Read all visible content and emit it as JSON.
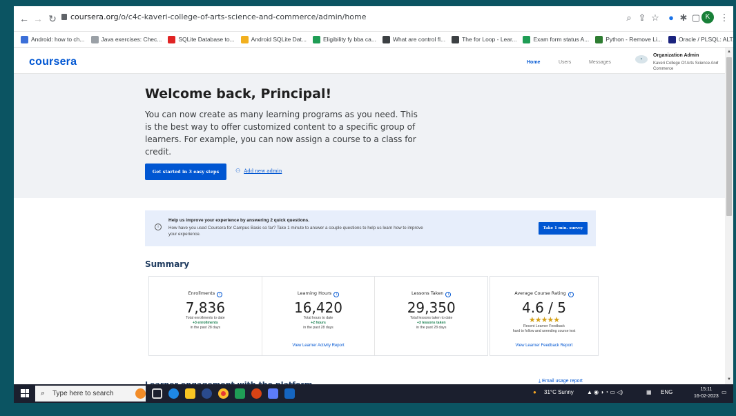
{
  "browser": {
    "url_host": "coursera.org",
    "url_path": "/o/c4c-kaveri-college-of-arts-science-and-commerce/admin/home",
    "profile_initial": "K",
    "bookmarks": [
      {
        "label": "Android: how to ch...",
        "color": "#3b6fd8"
      },
      {
        "label": "Java exercises: Chec...",
        "color": "#9aa0a6"
      },
      {
        "label": "SQLite Database to...",
        "color": "#e02424"
      },
      {
        "label": "Android SQLite Dat...",
        "color": "#f2b01e"
      },
      {
        "label": "Eligibility fy bba ca...",
        "color": "#1f9d55"
      },
      {
        "label": "What are control fl...",
        "color": "#3c4043"
      },
      {
        "label": "The for Loop - Lear...",
        "color": "#3c4043"
      },
      {
        "label": "Exam form status A...",
        "color": "#1f9d55"
      },
      {
        "label": "Python - Remove Li...",
        "color": "#2e7d32"
      },
      {
        "label": "Oracle / PLSQL: ALT...",
        "color": "#1a237e"
      }
    ],
    "more_bookmarks": "»"
  },
  "header": {
    "logo": "coursera",
    "nav": [
      "Home",
      "Users",
      "Messages"
    ],
    "org_title": "Organization Admin",
    "org_name": "Kaveri College Of Arts Science And Commerce"
  },
  "hero": {
    "title": "Welcome back, Principal!",
    "description": "You can now create as many learning programs as you need. This is the best way to offer customized content to a specific group of learners. For example, you can now assign a course to a class for credit.",
    "cta": "Get started in 3 easy steps",
    "add_admin": "Add new admin"
  },
  "survey": {
    "title": "Help us improve your experience by answering 2 quick questions.",
    "text": "How have you used Coursera for Campus Basic so far? Take 1 minute to answer a couple questions to help us learn how to improve your experience.",
    "button": "Take 1 min. survey"
  },
  "summary": {
    "title": "Summary",
    "stats": [
      {
        "label": "Enrollments",
        "value": "7,836",
        "sub": "Total enrollments to date",
        "delta": "+3 enrollments",
        "period": "in the past 28 days",
        "link": ""
      },
      {
        "label": "Learning Hours",
        "value": "16,420",
        "sub": "Total hours to date",
        "delta": "+2 hours",
        "period": "in the past 28 days",
        "link": "View Learner Activity Report"
      },
      {
        "label": "Lessons Taken",
        "value": "29,350",
        "sub": "Total lessons taken to date",
        "delta": "+3 lessons taken",
        "period": "in the past 28 days",
        "link": ""
      }
    ],
    "rating": {
      "label": "Average Course Rating",
      "value": "4.6 / 5",
      "stars": "★★★★★",
      "sub": "Recent Learner Feedback",
      "note": "hard to follow and unending course test",
      "link": "View Learner Feedback Report"
    }
  },
  "engagement": {
    "title": "Learner engagement with the platform",
    "email_report": "Email usage report"
  },
  "taskbar": {
    "search_placeholder": "Type here to search",
    "weather": "31°C  Sunny",
    "lang": "ENG",
    "time": "15:11",
    "date": "16-02-2023"
  }
}
